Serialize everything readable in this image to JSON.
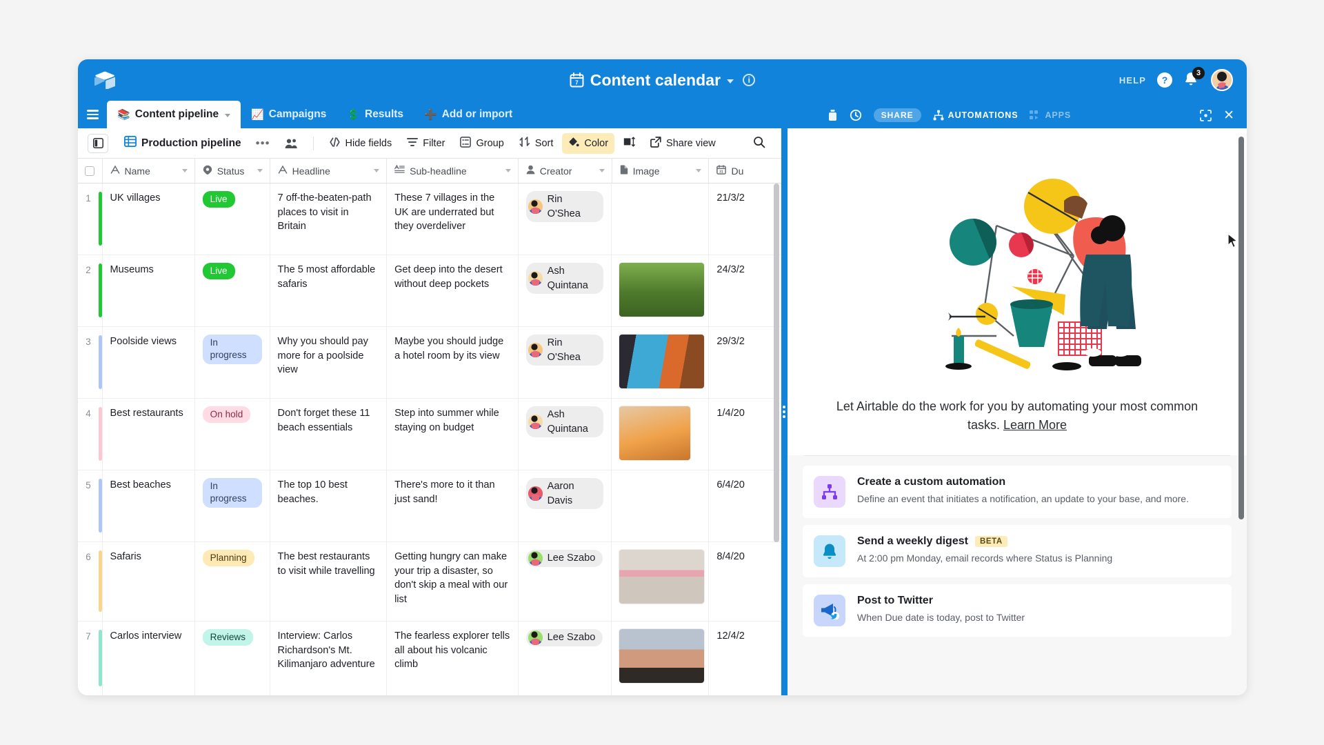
{
  "header": {
    "logo_icon": "airtable-logo-icon",
    "base_title": "Content calendar",
    "calendar_icon": "calendar-icon",
    "title_caret_icon": "chevron-down-icon",
    "info_icon": "info-icon",
    "info_glyph": "i",
    "help_label": "HELP",
    "help_icon": "question-mark-icon",
    "bell_icon": "bell-icon",
    "notification_count": "3",
    "avatar_icon": "user-avatar",
    "brand_blue": "#1283da"
  },
  "tabs": {
    "menu_icon": "hamburger-menu-icon",
    "items": [
      {
        "label": "Content pipeline",
        "emoji": "📚",
        "icon": "books-icon",
        "active": true,
        "caret_icon": "chevron-down-icon"
      },
      {
        "label": "Campaigns",
        "emoji": "📈",
        "icon": "chart-icon",
        "active": false
      },
      {
        "label": "Results",
        "emoji": "💲",
        "icon": "dollar-icon",
        "active": false
      },
      {
        "label": "Add or import",
        "emoji": "➕",
        "icon": "plus-square-icon",
        "active": false
      }
    ],
    "right_actions": [
      {
        "name": "trash",
        "icon": "trash-icon",
        "label": ""
      },
      {
        "name": "history",
        "icon": "clock-history-icon",
        "label": ""
      },
      {
        "name": "share",
        "icon": "",
        "label": "SHARE",
        "style": "pill"
      },
      {
        "name": "automations",
        "icon": "automations-icon",
        "label": "AUTOMATIONS",
        "style": "bright"
      },
      {
        "name": "apps",
        "icon": "apps-icon",
        "label": "APPS",
        "style": "dim"
      },
      {
        "name": "fullscreen",
        "icon": "fullscreen-icon",
        "label": ""
      },
      {
        "name": "close",
        "icon": "close-icon",
        "label": "✕"
      }
    ]
  },
  "toolbar": {
    "sidebar_toggle_icon": "sidebar-toggle-icon",
    "grid_icon": "grid-view-icon",
    "view_name": "Production pipeline",
    "more_label": "•••",
    "collaborators_icon": "collaborators-icon",
    "buttons": [
      {
        "label": "Hide fields",
        "icon": "hide-fields-icon",
        "highlight": false
      },
      {
        "label": "Filter",
        "icon": "filter-icon",
        "highlight": false
      },
      {
        "label": "Group",
        "icon": "group-icon",
        "highlight": false
      },
      {
        "label": "Sort",
        "icon": "sort-icon",
        "highlight": false
      },
      {
        "label": "Color",
        "icon": "color-palette-icon",
        "highlight": true
      },
      {
        "label": "",
        "icon": "row-height-icon",
        "highlight": false
      },
      {
        "label": "Share view",
        "icon": "share-view-icon",
        "highlight": false
      }
    ],
    "search_icon": "search-icon"
  },
  "grid": {
    "columns": [
      {
        "label": "Name",
        "icon": "text-field-icon",
        "caret": "chevron-down-icon"
      },
      {
        "label": "Status",
        "icon": "single-select-icon",
        "caret": "chevron-down-icon"
      },
      {
        "label": "Headline",
        "icon": "text-field-icon",
        "caret": "chevron-down-icon"
      },
      {
        "label": "Sub-headline",
        "icon": "long-text-icon",
        "caret": "chevron-down-icon"
      },
      {
        "label": "Creator",
        "icon": "user-field-icon",
        "caret": "chevron-down-icon"
      },
      {
        "label": "Image",
        "icon": "attachment-icon",
        "caret": "chevron-down-icon"
      },
      {
        "label": "Du",
        "icon": "date-field-icon",
        "caret": ""
      }
    ],
    "rows": [
      {
        "num": "1",
        "name": "UK villages",
        "status": "Live",
        "status_bg": "#20c933",
        "status_fg": "#ffffff",
        "bar": "#20c933",
        "headline": "7 off-the-beaten-path places to visit in Britain",
        "sub": "These 7 villages in the UK are underrated but they overdeliver",
        "creator": "Rin O'Shea",
        "creator_av": "#f5c77e",
        "image": "",
        "due": "21/3/2"
      },
      {
        "num": "2",
        "name": "Museums",
        "status": "Live",
        "status_bg": "#20c933",
        "status_fg": "#ffffff",
        "bar": "#20c933",
        "headline": "The 5 most affordable safaris",
        "sub": "Get deep into the desert without deep pockets",
        "creator": "Ash Quintana",
        "creator_av": "#f7dba4",
        "image": "zebra-photo",
        "due": "24/3/2"
      },
      {
        "num": "3",
        "name": "Poolside views",
        "status": "In progress",
        "status_bg": "#cfdfff",
        "status_fg": "#2d3f63",
        "bar": "#adc6f7",
        "headline": "Why you should pay more for a poolside view",
        "sub": "Maybe you should judge a hotel room by its view",
        "creator": "Rin O'Shea",
        "creator_av": "#f5c77e",
        "image": "pool-photo",
        "due": "29/3/2"
      },
      {
        "num": "4",
        "name": "Best restaurants",
        "status": "On hold",
        "status_bg": "#ffdce5",
        "status_fg": "#8b2b4a",
        "bar": "#fcc7d3",
        "headline": "Don't forget these 11 beach essentials",
        "sub": "Step into summer while staying on budget",
        "creator": "Ash Quintana",
        "creator_av": "#f7dba4",
        "image": "sunhat-photo",
        "due": "1/4/20"
      },
      {
        "num": "5",
        "name": "Best beaches",
        "status": "In progress",
        "status_bg": "#cfdfff",
        "status_fg": "#2d3f63",
        "bar": "#adc6f7",
        "headline": "The top 10 best beaches.",
        "sub": "There's more to it than just sand!",
        "creator": "Aaron Davis",
        "creator_av": "#e85b6a",
        "image": "",
        "due": "6/4/20"
      },
      {
        "num": "6",
        "name": "Safaris",
        "status": "Planning",
        "status_bg": "#ffeab6",
        "status_fg": "#4a3a10",
        "bar": "#f9d48b",
        "headline": "The best restaurants to visit while travelling",
        "sub": "Getting hungry can make your trip a disaster, so don't skip a meal with our list",
        "creator": "Lee Szabo",
        "creator_av": "#9ade6e",
        "image": "storefront-photo",
        "due": "8/4/20"
      },
      {
        "num": "7",
        "name": "Carlos interview",
        "status": "Reviews",
        "status_bg": "#c2f5e9",
        "status_fg": "#14453c",
        "bar": "#8fe6cf",
        "headline": "Interview: Carlos Richardson's Mt. Kilimanjaro adventure",
        "sub": "The fearless explorer tells all about his volcanic climb",
        "creator": "Lee Szabo",
        "creator_av": "#9ade6e",
        "image": "kilimanjaro-photo",
        "due": "12/4/2"
      }
    ]
  },
  "panel": {
    "illustration": "automations-illustration",
    "promo_text": "Let Airtable do the work for you by automating your most common tasks. ",
    "promo_link": "Learn More",
    "cards": [
      {
        "title": "Create a custom automation",
        "badge": "",
        "desc": "Define an event that initiates a notification, an update to your base, and more.",
        "icon": "automation-node-icon",
        "icon_bg": "#ead9fd",
        "icon_fg": "#7c3aed"
      },
      {
        "title": "Send a weekly digest",
        "badge": "BETA",
        "desc": "At 2:00 pm Monday, email records where Status is Planning",
        "icon": "bell-icon",
        "icon_bg": "#c5e9fb",
        "icon_fg": "#0a8ec4"
      },
      {
        "title": "Post to Twitter",
        "badge": "",
        "desc": "When Due date is today, post to Twitter",
        "icon": "megaphone-icon",
        "icon_bg": "#c8d6fb",
        "icon_fg": "#1a66c9"
      }
    ]
  },
  "cursor": {
    "icon": "mouse-pointer-icon"
  }
}
